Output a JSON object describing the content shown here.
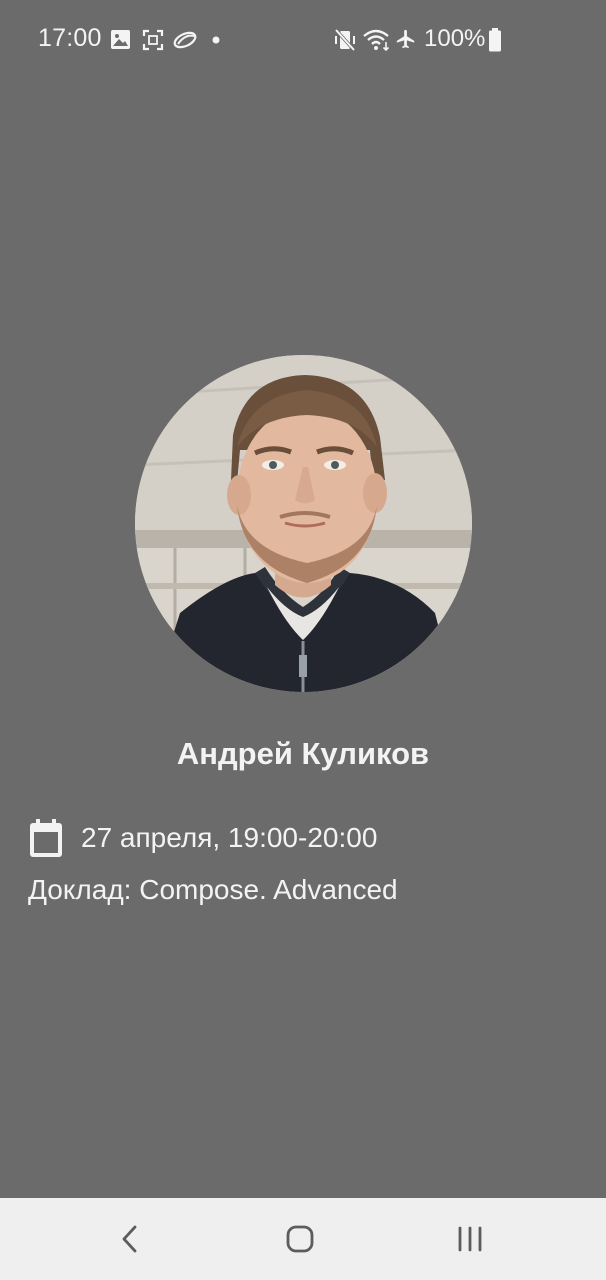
{
  "status_bar": {
    "time": "17:00",
    "battery": "100%",
    "left_icons": [
      "gallery-icon",
      "screenshot-icon",
      "app-notification-icon",
      "more-dot-icon"
    ],
    "right_icons": [
      "mute-vibrate-icon",
      "wifi-icon",
      "airplane-icon",
      "battery-icon"
    ]
  },
  "speaker": {
    "name": "Андрей Куликов",
    "avatar_icon": "speaker-photo"
  },
  "session": {
    "date_icon": "calendar-icon",
    "datetime": "27 апреля, 19:00-20:00",
    "talk": "Доклад: Compose. Advanced"
  },
  "nav_bar": {
    "buttons": [
      "back-icon",
      "home-icon",
      "recents-icon"
    ]
  },
  "colors": {
    "background": "#6b6b6b",
    "text": "#f2f2f2",
    "nav_background": "#efefef",
    "nav_icon": "#5c5c5c"
  }
}
